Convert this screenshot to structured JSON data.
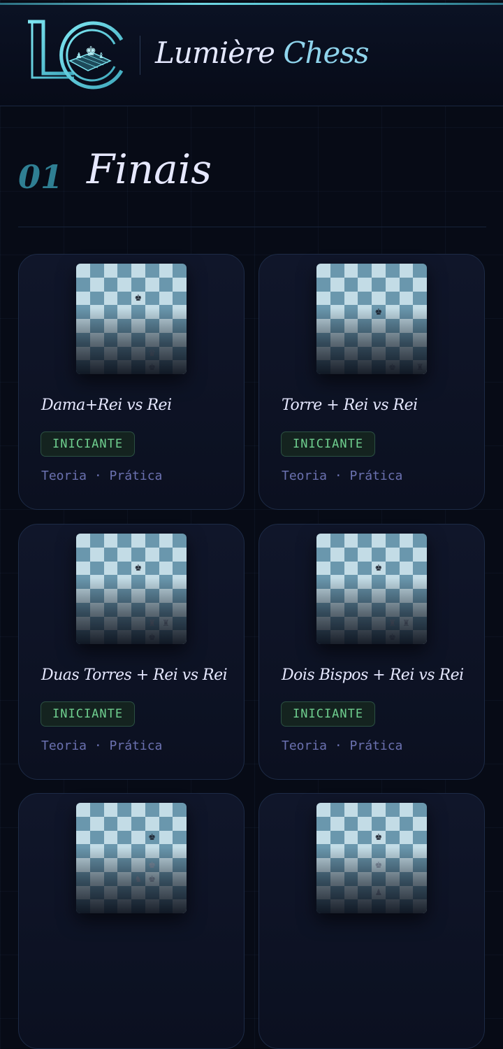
{
  "brand": {
    "logo_letters": "LC",
    "name_first": "Lumière",
    "name_second": "Chess"
  },
  "section": {
    "number": "01",
    "title": "Finais"
  },
  "colors": {
    "accent": "#4ab8c8",
    "badge_text": "#6fcf8f",
    "meta_text": "#6b71b0"
  },
  "cards": [
    {
      "title": "Dama+Rei vs Rei",
      "level": "INICIANTE",
      "meta": "Teoria · Prática",
      "pieces": [
        {
          "square": "e6",
          "glyph": "♚",
          "color": "black"
        },
        {
          "square": "f2",
          "glyph": "♛",
          "color": "white"
        },
        {
          "square": "f1",
          "glyph": "♚",
          "color": "white"
        }
      ]
    },
    {
      "title": "Torre + Rei vs Rei",
      "level": "INICIANTE",
      "meta": "Teoria · Prática",
      "pieces": [
        {
          "square": "e5",
          "glyph": "♚",
          "color": "black"
        },
        {
          "square": "f1",
          "glyph": "♚",
          "color": "white"
        },
        {
          "square": "h1",
          "glyph": "♜",
          "color": "white"
        }
      ]
    },
    {
      "title": "Duas Torres + Rei vs Rei",
      "level": "INICIANTE",
      "meta": "Teoria · Prática",
      "pieces": [
        {
          "square": "e6",
          "glyph": "♚",
          "color": "black"
        },
        {
          "square": "f2",
          "glyph": "♜",
          "color": "white"
        },
        {
          "square": "g2",
          "glyph": "♜",
          "color": "white"
        },
        {
          "square": "f1",
          "glyph": "♚",
          "color": "white"
        }
      ]
    },
    {
      "title": "Dois Bispos + Rei vs Rei",
      "level": "INICIANTE",
      "meta": "Teoria · Prática",
      "pieces": [
        {
          "square": "e6",
          "glyph": "♚",
          "color": "black"
        },
        {
          "square": "f2",
          "glyph": "♜",
          "color": "white"
        },
        {
          "square": "g2",
          "glyph": "♜",
          "color": "white"
        },
        {
          "square": "f1",
          "glyph": "♚",
          "color": "white"
        }
      ]
    },
    {
      "title": "",
      "level": "",
      "meta": "",
      "pieces": [
        {
          "square": "f6",
          "glyph": "♚",
          "color": "black"
        },
        {
          "square": "f4",
          "glyph": "♚",
          "color": "white"
        },
        {
          "square": "e3",
          "glyph": "♞",
          "color": "white"
        },
        {
          "square": "f3",
          "glyph": "♚",
          "color": "white"
        }
      ]
    },
    {
      "title": "",
      "level": "",
      "meta": "",
      "pieces": [
        {
          "square": "e6",
          "glyph": "♚",
          "color": "black"
        },
        {
          "square": "e4",
          "glyph": "♚",
          "color": "white"
        },
        {
          "square": "e2",
          "glyph": "♟",
          "color": "white"
        }
      ]
    }
  ]
}
